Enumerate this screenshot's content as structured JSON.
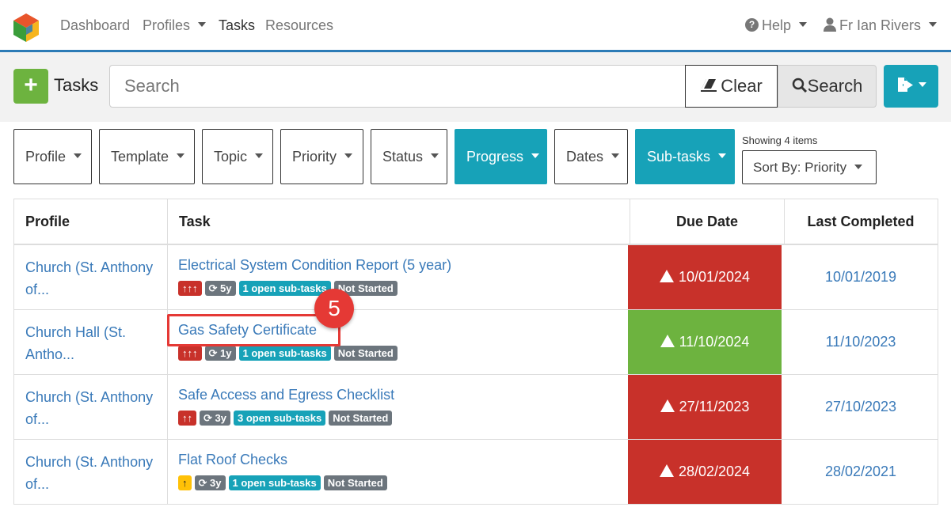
{
  "nav": {
    "items": [
      {
        "label": "Dashboard"
      },
      {
        "label": "Profiles"
      },
      {
        "label": "Tasks"
      },
      {
        "label": "Resources"
      }
    ],
    "help_label": "Help",
    "user_label": "Fr Ian Rivers"
  },
  "toolbar": {
    "title": "Tasks",
    "search_placeholder": "Search",
    "clear_label": "Clear",
    "search_label": "Search"
  },
  "filters": [
    {
      "label": "Profile"
    },
    {
      "label": "Template"
    },
    {
      "label": "Topic"
    },
    {
      "label": "Priority"
    },
    {
      "label": "Status"
    },
    {
      "label": "Progress"
    },
    {
      "label": "Dates"
    },
    {
      "label": "Sub-tasks"
    }
  ],
  "showing_text": "Showing 4 items",
  "sort_label": "Sort By: Priority",
  "table": {
    "headers": {
      "profile": "Profile",
      "task": "Task",
      "due": "Due Date",
      "last": "Last Completed"
    },
    "rows": [
      {
        "profile": "Church (St. Anthony of...",
        "task": "Electrical System Condition Report (5 year)",
        "priority": "↑↑↑",
        "recur": "5y",
        "subtasks": "1 open sub-tasks",
        "status": "Not Started",
        "due": "10/01/2024",
        "last": "10/01/2019"
      },
      {
        "profile": "Church Hall (St. Antho...",
        "task": "Gas Safety Certificate",
        "priority": "↑↑↑",
        "recur": "1y",
        "subtasks": "1 open sub-tasks",
        "status": "Not Started",
        "due": "11/10/2024",
        "last": "11/10/2023"
      },
      {
        "profile": "Church (St. Anthony of...",
        "task": "Safe Access and Egress Checklist",
        "priority": "↑↑",
        "recur": "3y",
        "subtasks": "3 open sub-tasks",
        "status": "Not Started",
        "due": "27/11/2023",
        "last": "27/10/2023"
      },
      {
        "profile": "Church (St. Anthony of...",
        "task": "Flat Roof Checks",
        "priority": "↑",
        "recur": "3y",
        "subtasks": "1 open sub-tasks",
        "status": "Not Started",
        "due": "28/02/2024",
        "last": "28/02/2021"
      }
    ]
  },
  "annotation": {
    "step": "5"
  },
  "colors": {
    "accent": "#2c7bb6",
    "teal": "#17a2b8",
    "danger": "#c8312a",
    "success": "#6db33f",
    "warning": "#ffc107",
    "link": "#3a7ab9"
  }
}
